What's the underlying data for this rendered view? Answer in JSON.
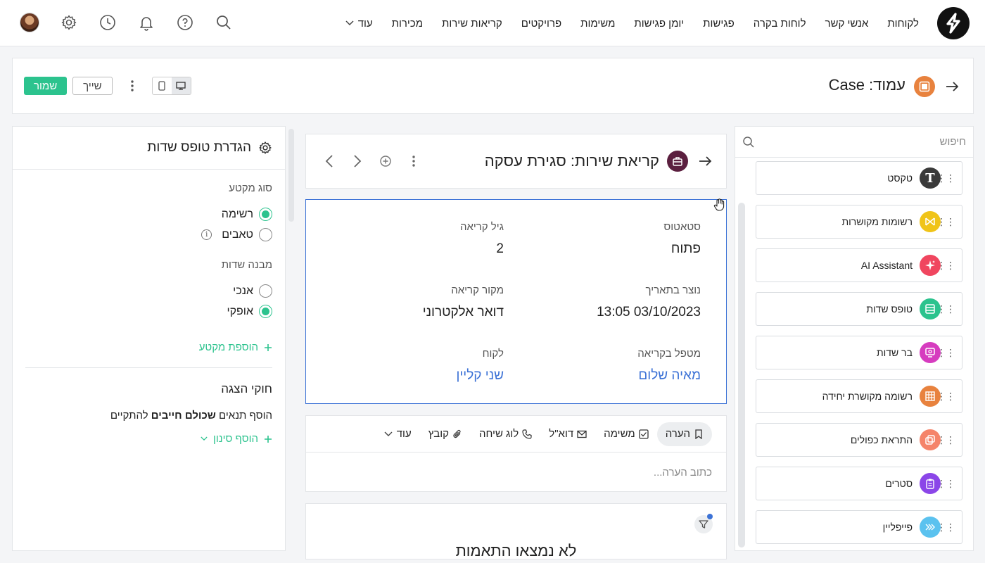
{
  "nav": {
    "items": [
      "לקוחות",
      "אנשי קשר",
      "לוחות בקרה",
      "פגישות",
      "יומן פגישות",
      "משימות",
      "פרויקטים",
      "קריאות שירות",
      "מכירות"
    ],
    "more_label": "עוד"
  },
  "page": {
    "title": "עמוד: Case",
    "save_label": "שמור",
    "assign_label": "שייך"
  },
  "components": {
    "search_placeholder": "חיפוש",
    "items": [
      {
        "label": "טקסט",
        "icon": "text-icon",
        "color": "#3a3a3a"
      },
      {
        "label": "רשומות מקושרות",
        "icon": "linked-records-icon",
        "color": "#f0c419"
      },
      {
        "label": "AI Assistant",
        "icon": "sparkle-icon",
        "color": "#f0465f"
      },
      {
        "label": "טופס שדות",
        "icon": "form-icon",
        "color": "#2cc38e"
      },
      {
        "label": "בר שדות",
        "icon": "fields-bar-icon",
        "color": "#d63cbf"
      },
      {
        "label": "רשומה מקושרת יחידה",
        "icon": "grid-icon",
        "color": "#e8823e"
      },
      {
        "label": "התראת כפולים",
        "icon": "duplicate-icon",
        "color": "#f5846a"
      },
      {
        "label": "סטרים",
        "icon": "clipboard-icon",
        "color": "#8b46e8"
      },
      {
        "label": "פייפליין",
        "icon": "pipeline-icon",
        "color": "#5bc2ef"
      }
    ]
  },
  "record": {
    "title": "קריאת שירות: סגירת עסקה",
    "fields_right": [
      {
        "label": "סטאטוס",
        "value": "פתוח"
      },
      {
        "label": "נוצר בתאריך",
        "value": "03/10/2023 13:05"
      },
      {
        "label": "מטפל בקריאה",
        "value": "מאיה שלום"
      }
    ],
    "fields_left": [
      {
        "label": "גיל קריאה",
        "value": "2"
      },
      {
        "label": "מקור קריאה",
        "value": "דואר אלקטרוני"
      },
      {
        "label": "לקוח",
        "value": "שני קליין"
      }
    ]
  },
  "activity": {
    "tabs": [
      "הערה",
      "משימה",
      "דוא\"ל",
      "לוג שיחה",
      "קובץ"
    ],
    "more_label": "עוד",
    "note_placeholder": "כתוב הערה..."
  },
  "results": {
    "empty_text": "לא נמצאו התאמות"
  },
  "settings": {
    "title": "הגדרת טופס שדות",
    "section_type_label": "סוג מקטע",
    "section_types": [
      "רשימה",
      "טאבים"
    ],
    "structure_label": "מבנה שדות",
    "structures": [
      "אנכי",
      "אופקי"
    ],
    "add_section": "הוספת מקטע",
    "rules_title": "חוקי הצגה",
    "rules_desc_prefix": "הוסף תנאים",
    "rules_desc_bold": "שכולם חייבים",
    "rules_desc_suffix": "להתקיים",
    "add_filter": "הוסף סינון"
  }
}
